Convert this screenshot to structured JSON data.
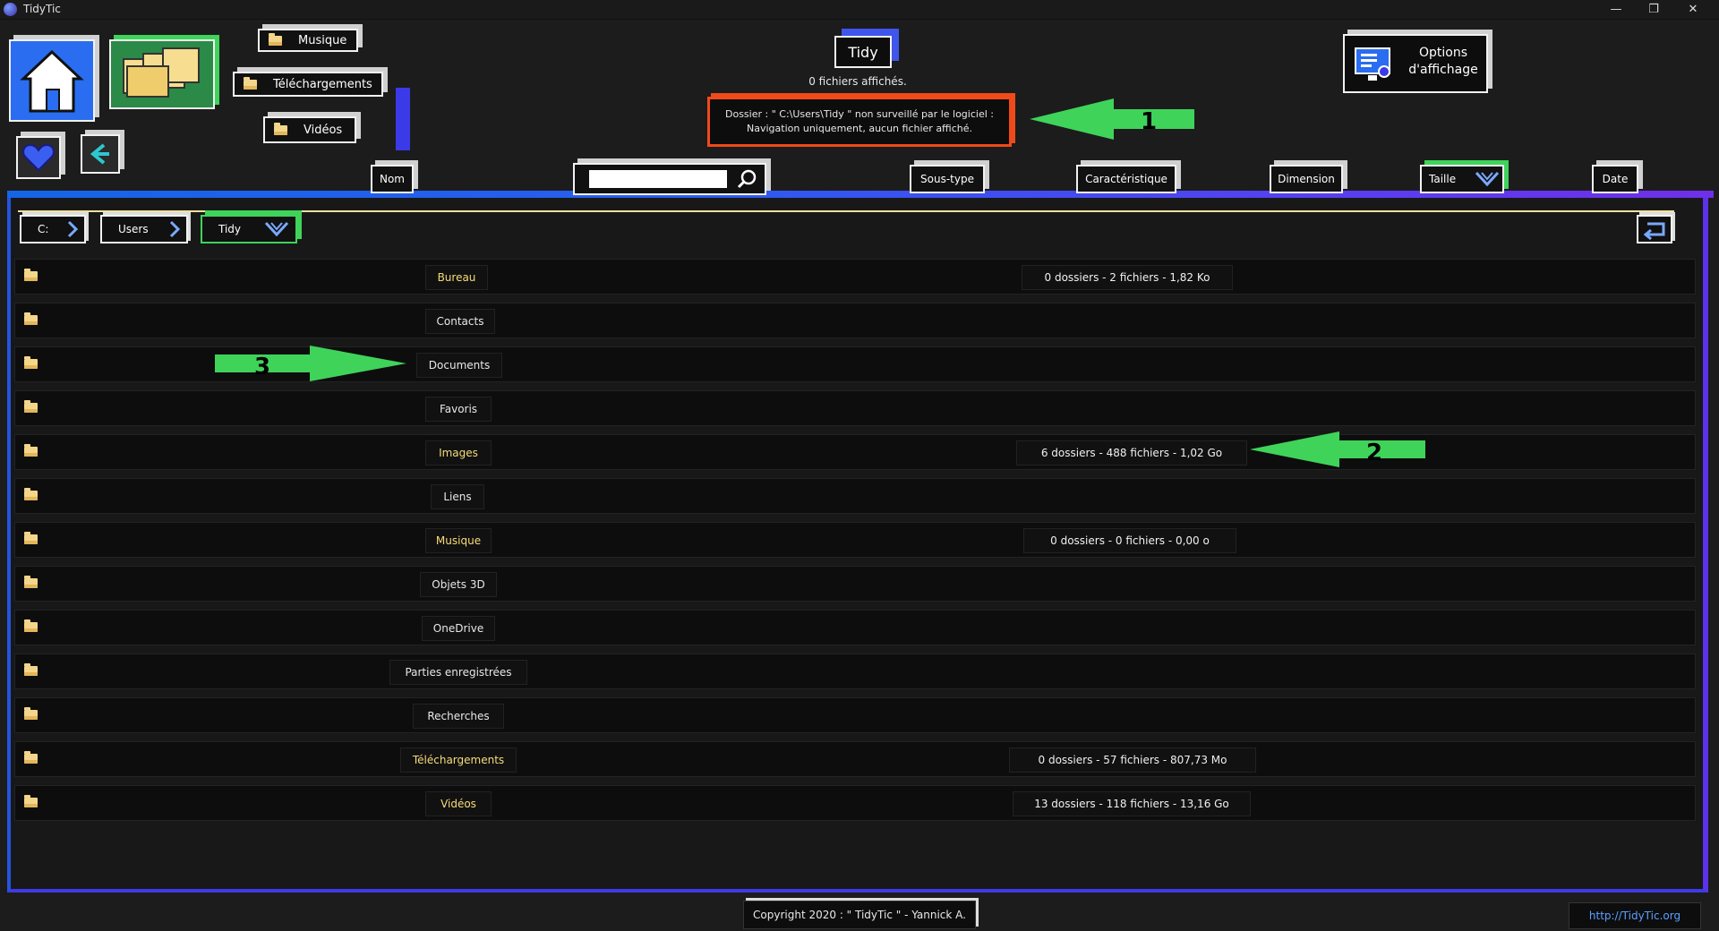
{
  "window": {
    "title": "TidyTic",
    "minimize": "—",
    "restore": "❐",
    "close": "✕"
  },
  "quick_access": [
    "Musique",
    "Téléchargements",
    "Vidéos"
  ],
  "tidy": {
    "label": "Tidy",
    "files_shown": "0 fichiers affichés."
  },
  "warning": {
    "line1": "Dossier : \" C:\\Users\\Tidy \" non surveillé par le logiciel :",
    "line2": "Navigation uniquement, aucun fichier affiché."
  },
  "options": {
    "line1": "Options",
    "line2": "d'affichage"
  },
  "columns": {
    "nom": "Nom",
    "sous_type": "Sous-type",
    "caracteristique": "Caractéristique",
    "dimension": "Dimension",
    "taille": "Taille",
    "date": "Date"
  },
  "search": {
    "placeholder": ""
  },
  "breadcrumb": [
    "C:",
    "Users",
    "Tidy"
  ],
  "rows": [
    {
      "name": "Bureau",
      "info": "0 dossiers   -   2 fichiers   -   1,82 Ko",
      "highlight": true
    },
    {
      "name": "Contacts",
      "info": "",
      "highlight": false
    },
    {
      "name": "Documents",
      "info": "",
      "highlight": false
    },
    {
      "name": "Favoris",
      "info": "",
      "highlight": false
    },
    {
      "name": "Images",
      "info": "6 dossiers   -   488 fichiers   -   1,02 Go",
      "highlight": true
    },
    {
      "name": "Liens",
      "info": "",
      "highlight": false
    },
    {
      "name": "Musique",
      "info": "0 dossiers   -   0 fichiers   -   0,00 o",
      "highlight": true
    },
    {
      "name": "Objets 3D",
      "info": "",
      "highlight": false
    },
    {
      "name": "OneDrive",
      "info": "",
      "highlight": false
    },
    {
      "name": "Parties enregistrées",
      "info": "",
      "highlight": false
    },
    {
      "name": "Recherches",
      "info": "",
      "highlight": false
    },
    {
      "name": "Téléchargements",
      "info": "0 dossiers   -   57 fichiers   -   807,73 Mo",
      "highlight": true
    },
    {
      "name": "Vidéos",
      "info": "13 dossiers   -   118 fichiers   -   13,16 Go",
      "highlight": true
    }
  ],
  "annotations": [
    "1",
    "2",
    "3"
  ],
  "footer": {
    "copyright": "Copyright 2020 : \" TidyTic \" - Yannick A.",
    "url": "http://TidyTic.org"
  },
  "colors": {
    "accent_blue": "#1565e8",
    "accent_purple": "#6f2fe8",
    "arrow_green": "#3fd35a",
    "warning_border": "#f04a1a"
  }
}
